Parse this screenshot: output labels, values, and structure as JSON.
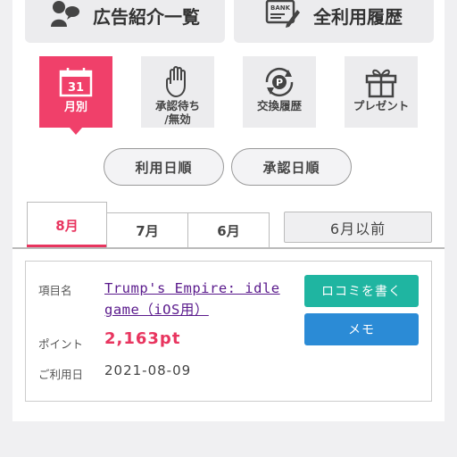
{
  "top_menu": {
    "ads_label": "広告紹介一覧",
    "history_label": "全利用履歴",
    "bank_text": "BANK"
  },
  "tiles": {
    "month": {
      "number": "31",
      "label": "月別"
    },
    "pending": {
      "label_line1": "承認待ち",
      "label_line2": "/無効"
    },
    "exchange": {
      "label": "交換履歴"
    },
    "present": {
      "label": "プレゼント"
    }
  },
  "sort": {
    "use_date": "利用日順",
    "approval_date": "承認日順"
  },
  "tabs": {
    "aug": "8月",
    "jul": "7月",
    "jun": "6月",
    "before": "6月以前"
  },
  "entry": {
    "item_label": "項目名",
    "item_name": "Trump's Empire: idle game（iOS用）",
    "points_label": "ポイント",
    "points": "2,163pt",
    "date_label": "ご利用日",
    "date": "2021-08-09",
    "review_button": "ロコミを書く",
    "memo_button": "メモ"
  },
  "colors": {
    "accent": "#f0406a",
    "review": "#1fb5a1",
    "memo": "#2b8bd6",
    "link": "#5a1a8c"
  }
}
